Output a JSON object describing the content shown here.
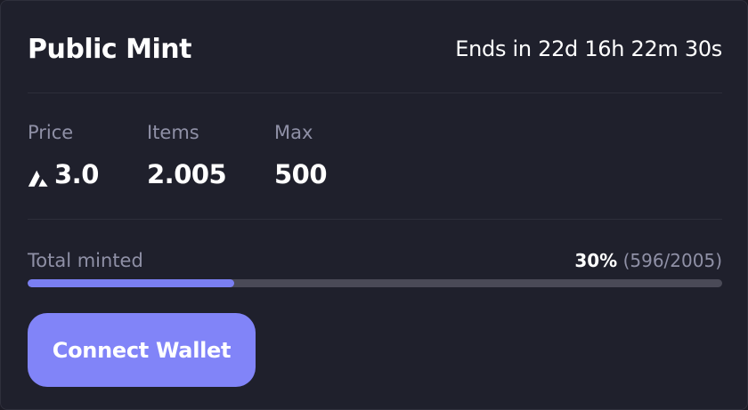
{
  "mint": {
    "title": "Public Mint",
    "countdown": "Ends in 22d 16h 22m 30s"
  },
  "stats": [
    {
      "label": "Price",
      "value": "3.0",
      "icon": "avalanche-token-icon"
    },
    {
      "label": "Items",
      "value": "2.005"
    },
    {
      "label": "Max",
      "value": "500"
    }
  ],
  "progress": {
    "label": "Total minted",
    "percent_text": "30%",
    "count_text": "(596/2005)",
    "fraction": 0.2973
  },
  "actions": {
    "connect_label": "Connect Wallet"
  },
  "colors": {
    "accent": "#8184f8",
    "bar_fill": "#7a7ff2",
    "bar_track": "#4a4a57",
    "background": "#1f202c",
    "muted_text": "#8f90a6"
  }
}
